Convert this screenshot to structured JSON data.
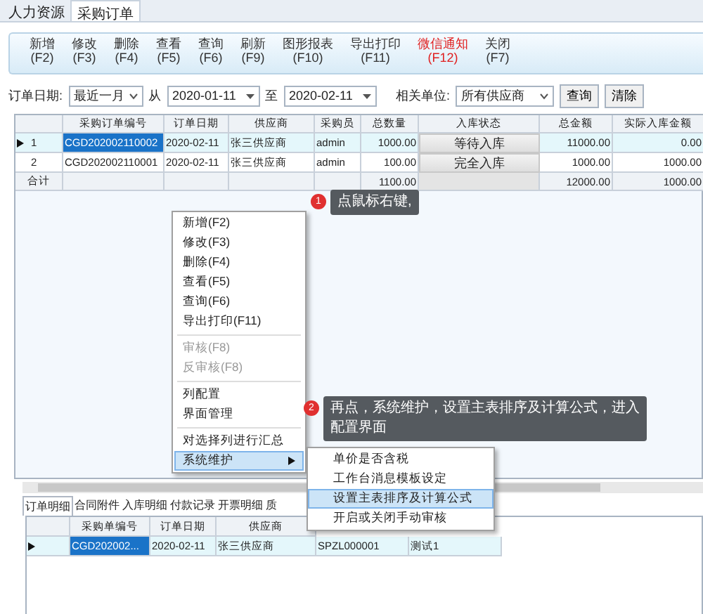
{
  "top_tabs": [
    {
      "label": "人力资源",
      "selected": false
    },
    {
      "label": "采购订单",
      "selected": true
    }
  ],
  "toolbar": [
    {
      "label": "新增",
      "key": "(F2)",
      "kind": "normal"
    },
    {
      "label": "修改",
      "key": "(F3)",
      "kind": "normal"
    },
    {
      "label": "删除",
      "key": "(F4)",
      "kind": "normal"
    },
    {
      "label": "查看",
      "key": "(F5)",
      "kind": "normal"
    },
    {
      "label": "查询",
      "key": "(F6)",
      "kind": "normal"
    },
    {
      "label": "刷新",
      "key": "(F9)",
      "kind": "normal"
    },
    {
      "label": "图形报表",
      "key": "(F10)",
      "kind": "normal"
    },
    {
      "label": "导出打印",
      "key": "(F11)",
      "kind": "normal"
    },
    {
      "label": "微信通知",
      "key": "(F12)",
      "kind": "alert"
    },
    {
      "label": "关闭",
      "key": "(F7)",
      "kind": "normal"
    }
  ],
  "filter": {
    "date_label": "订单日期:",
    "period": "最近一月",
    "from_label": "从",
    "from": "2020-01-11",
    "to_label": "至",
    "to": "2020-02-11",
    "unit_label": "相关单位:",
    "unit": "所有供应商",
    "buttons": [
      "查询",
      "清除"
    ]
  },
  "table": {
    "columns": [
      "采购订单编号",
      "订单日期",
      "供应商",
      "采购员",
      "总数量",
      "入库状态",
      "总金额",
      "实际入库金额"
    ],
    "rows": [
      {
        "index": "1",
        "selected": true,
        "cells": [
          "CGD202002110002",
          "2020-02-11",
          "张三供应商",
          "admin",
          "1000.00",
          "等待入库",
          "11000.00",
          "0.00"
        ]
      },
      {
        "index": "2",
        "selected": false,
        "cells": [
          "CGD202002110001",
          "2020-02-11",
          "张三供应商",
          "admin",
          "100.00",
          "完全入库",
          "1000.00",
          "1000.00"
        ]
      }
    ],
    "total": {
      "label": "合计",
      "quantity": "1100.00",
      "amount": "12000.00",
      "actual": "1000.00"
    }
  },
  "context_menu": {
    "groups": [
      [
        {
          "label": "新增(F2)",
          "disabled": false,
          "selected": false,
          "submenu": false
        },
        {
          "label": "修改(F3)",
          "disabled": false,
          "selected": false,
          "submenu": false
        },
        {
          "label": "删除(F4)",
          "disabled": false,
          "selected": false,
          "submenu": false
        },
        {
          "label": "查看(F5)",
          "disabled": false,
          "selected": false,
          "submenu": false
        },
        {
          "label": "查询(F6)",
          "disabled": false,
          "selected": false,
          "submenu": false
        },
        {
          "label": "导出打印(F11)",
          "disabled": false,
          "selected": false,
          "submenu": false
        }
      ],
      [
        {
          "label": "审核(F8)",
          "disabled": true,
          "selected": false,
          "submenu": false
        },
        {
          "label": "反审核(F8)",
          "disabled": true,
          "selected": false,
          "submenu": false
        }
      ],
      [
        {
          "label": "列配置",
          "disabled": false,
          "selected": false,
          "submenu": false
        },
        {
          "label": "界面管理",
          "disabled": false,
          "selected": false,
          "submenu": false
        }
      ],
      [
        {
          "label": "对选择列进行汇总",
          "disabled": false,
          "selected": false,
          "submenu": false
        },
        {
          "label": "系统维护",
          "disabled": false,
          "selected": true,
          "submenu": true
        }
      ]
    ]
  },
  "submenu": [
    {
      "label": "单价是否含税",
      "selected": false
    },
    {
      "label": "工作台消息模板设定",
      "selected": false
    },
    {
      "label": "设置主表排序及计算公式",
      "selected": true
    },
    {
      "label": "开启或关闭手动审核",
      "selected": false
    }
  ],
  "callouts": [
    {
      "number": "1",
      "text": "点鼠标右键,"
    },
    {
      "number": "2",
      "text": "再点，系统维护，设置主表排序及计算公式，进入配置界面"
    }
  ],
  "detail_tabs": [
    {
      "label": "订单明细",
      "selected": true
    },
    {
      "label": "合同附件",
      "selected": false
    },
    {
      "label": "入库明细",
      "selected": false
    },
    {
      "label": "付款记录",
      "selected": false
    },
    {
      "label": "开票明细",
      "selected": false
    },
    {
      "label": "质",
      "selected": false
    }
  ],
  "detail_table": {
    "columns": [
      "采购单编号",
      "订单日期",
      "供应商"
    ],
    "rows": [
      {
        "selected": true,
        "cells": [
          "CGD202002...",
          "2020-02-11",
          "张三供应商",
          "SPZL000001",
          "测试1"
        ]
      }
    ]
  }
}
